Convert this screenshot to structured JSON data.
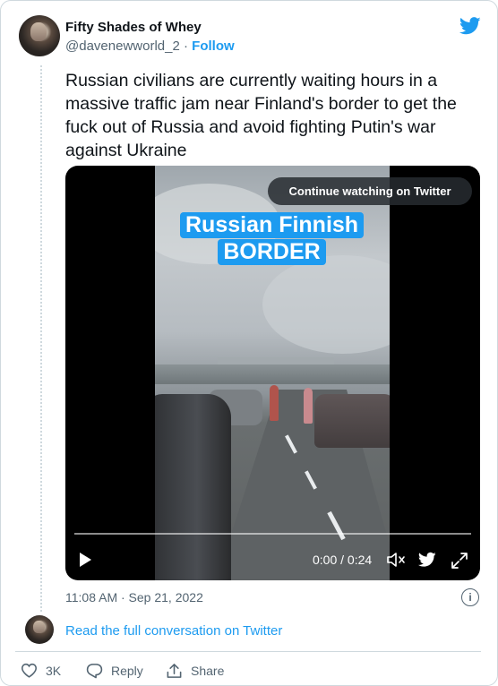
{
  "author": {
    "name": "Fifty Shades of Whey",
    "handle": "@davenewworld_2",
    "separator": "·",
    "follow_label": "Follow"
  },
  "tweet": {
    "text": "Russian civilians are currently waiting hours in a massive traffic jam near Finland's border to get the fuck out of Russia and avoid fighting Putin's war against Ukraine",
    "timestamp": "11:08 AM · Sep 21, 2022"
  },
  "video": {
    "overlay_line1": "Russian Finnish",
    "overlay_line2": "BORDER",
    "continue_label": "Continue watching on Twitter",
    "time_display": "0:00 / 0:24",
    "progress": 0
  },
  "conversation": {
    "read_full_label": "Read the full conversation on Twitter"
  },
  "actions": {
    "like_count": "3K",
    "reply_label": "Reply",
    "share_label": "Share"
  },
  "colors": {
    "accent": "#1d9bf0",
    "text": "#0f1419",
    "secondary": "#536471",
    "border": "#cfd9de"
  }
}
